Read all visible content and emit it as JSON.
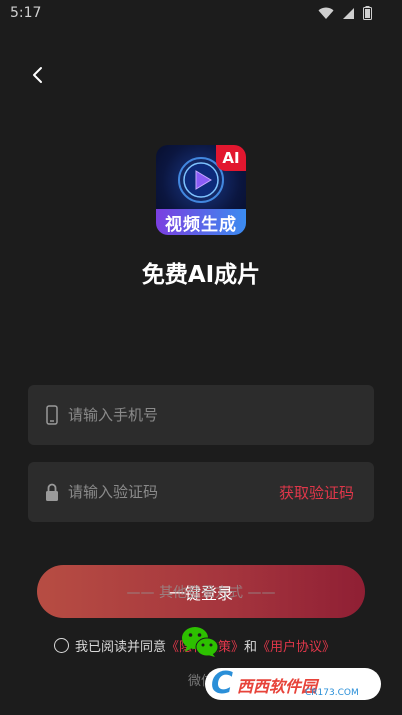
{
  "status_bar": {
    "time": "5:17"
  },
  "app": {
    "logo_badge": "AI",
    "logo_caption": "视频生成",
    "title": "免费AI成片"
  },
  "form": {
    "phone_placeholder": "请输入手机号",
    "code_placeholder": "请输入验证码",
    "get_code_label": "获取验证码",
    "login_label": "一键登录",
    "other_methods_label": "—— 其他登录方式 ——"
  },
  "agreement": {
    "prefix": "我已阅读并同意",
    "privacy_link": "《隐私政策》",
    "conjunction": "和",
    "user_agreement_link": "《用户协议》"
  },
  "wechat": {
    "label": "微信"
  },
  "watermark": {
    "text": "西西软件园",
    "sub": "CR173.COM",
    "letter": "C"
  },
  "colors": {
    "background": "#1c1c1c",
    "accent": "#e0374a",
    "button_start": "#b74d43",
    "button_end": "#8f1f34",
    "wechat": "#2dc100"
  }
}
